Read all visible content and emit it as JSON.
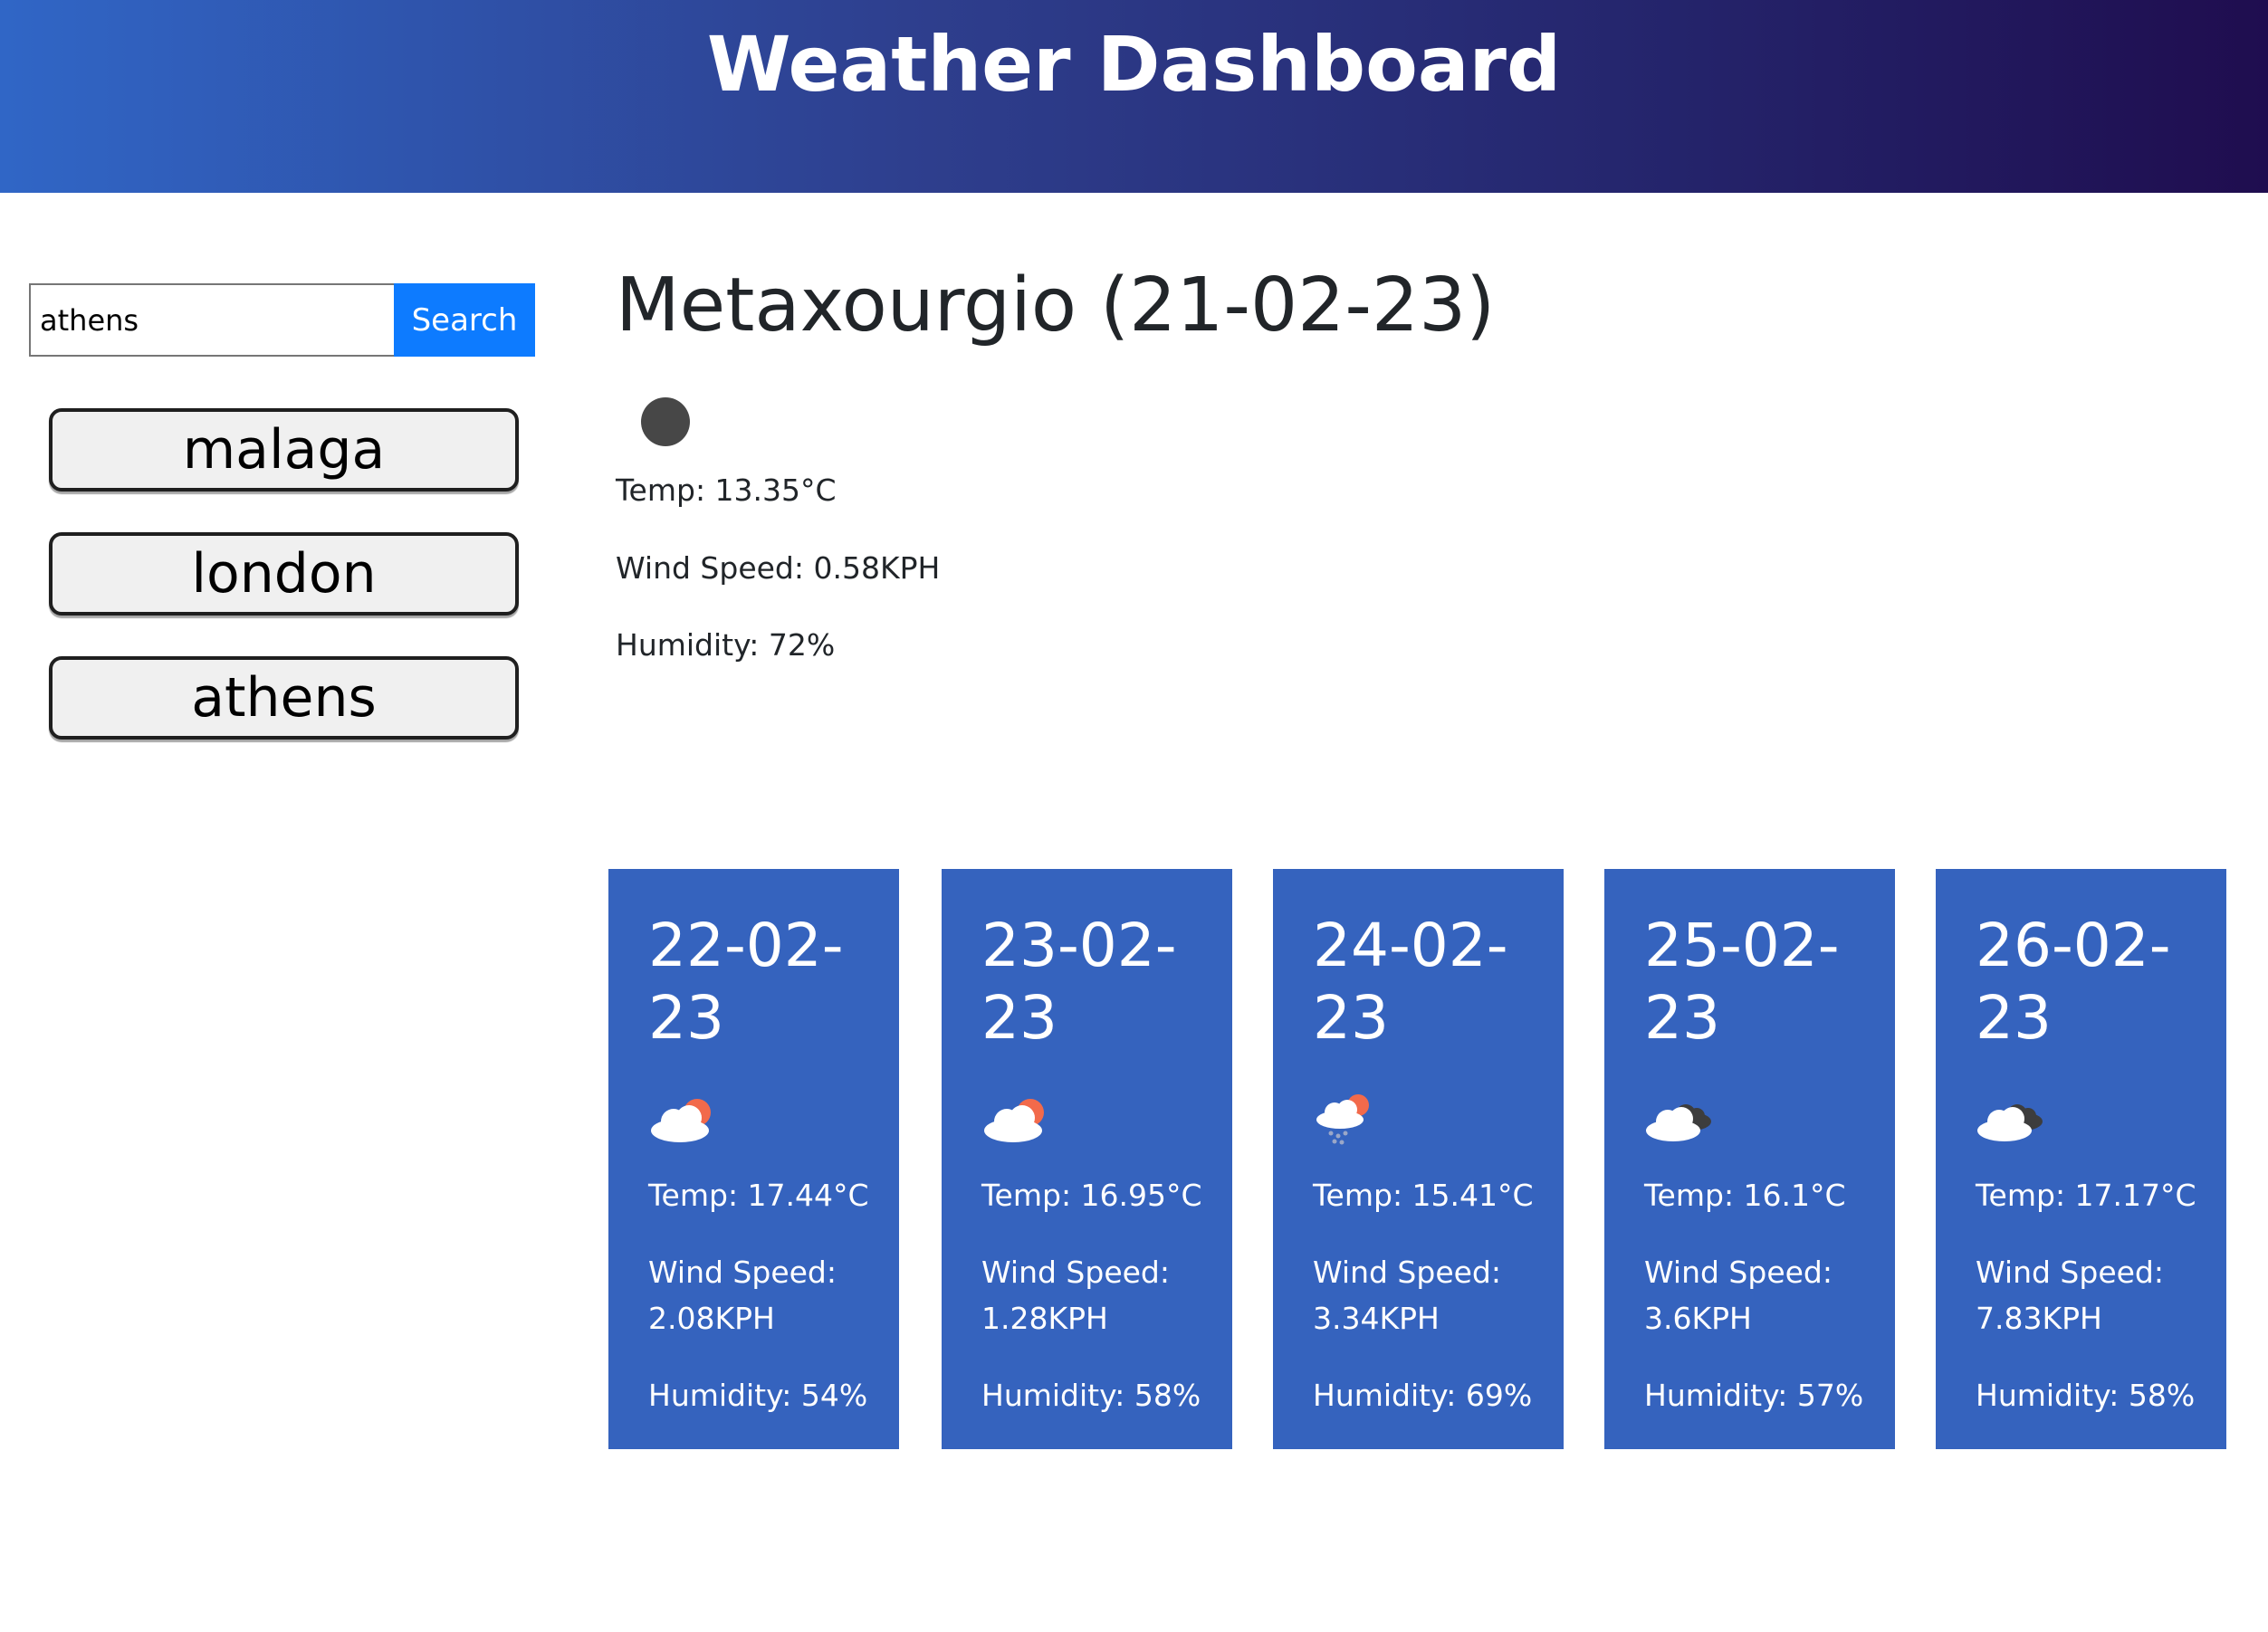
{
  "header": {
    "title": "Weather Dashboard"
  },
  "search": {
    "value": "athens",
    "button_label": "Search"
  },
  "history": [
    {
      "label": "malaga"
    },
    {
      "label": "london"
    },
    {
      "label": "athens"
    }
  ],
  "current": {
    "title": "Metaxourgio (21-02-23)",
    "icon": "moon-clear-night-icon",
    "temp": "Temp: 13.35°C",
    "wind": "Wind Speed: 0.58KPH",
    "humidity": "Humidity: 72%"
  },
  "forecast": [
    {
      "date": "22-02-23",
      "icon": "cloud-with-sun-icon",
      "temp": "Temp: 17.44°C",
      "wind": "Wind Speed: 2.08KPH",
      "humidity": "Humidity: 54%"
    },
    {
      "date": "23-02-23",
      "icon": "cloud-with-sun-icon",
      "temp": "Temp: 16.95°C",
      "wind": "Wind Speed: 1.28KPH",
      "humidity": "Humidity: 58%"
    },
    {
      "date": "24-02-23",
      "icon": "rain-cloud-with-sun-icon",
      "temp": "Temp: 15.41°C",
      "wind": "Wind Speed: 3.34KPH",
      "humidity": "Humidity: 69%"
    },
    {
      "date": "25-02-23",
      "icon": "broken-clouds-icon",
      "temp": "Temp: 16.1°C",
      "wind": "Wind Speed: 3.6KPH",
      "humidity": "Humidity: 57%"
    },
    {
      "date": "26-02-23",
      "icon": "broken-clouds-icon",
      "temp": "Temp: 17.17°C",
      "wind": "Wind Speed: 7.83KPH",
      "humidity": "Humidity: 58%"
    }
  ],
  "colors": {
    "header_start": "#3066c6",
    "header_end": "#1f0d4f",
    "search_button": "#0d7bff",
    "card_background": "#3563be",
    "sun": "#f26a4b"
  }
}
